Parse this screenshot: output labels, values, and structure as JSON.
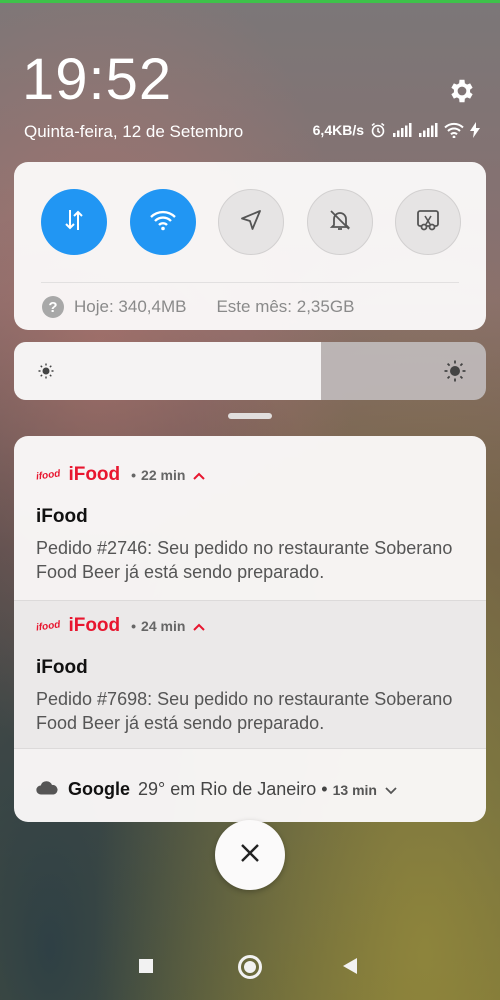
{
  "status_bar": {
    "time": "19:52",
    "date": "Quinta-feira, 12 de Setembro",
    "network_speed": "6,4KB/s",
    "icons": [
      "alarm-icon",
      "signal-icon",
      "signal-icon",
      "wifi-icon",
      "charging-icon"
    ]
  },
  "quick_settings": {
    "toggles": [
      {
        "name": "mobile-data",
        "icon": "data-arrows-icon",
        "active": true
      },
      {
        "name": "wifi",
        "icon": "wifi-icon",
        "active": true
      },
      {
        "name": "location",
        "icon": "location-arrow-icon",
        "active": false
      },
      {
        "name": "silent",
        "icon": "bell-off-icon",
        "active": false
      },
      {
        "name": "screenshot",
        "icon": "scissors-icon",
        "active": false
      }
    ],
    "data_usage": {
      "help_glyph": "?",
      "today": "Hoje: 340,4MB",
      "month": "Este mês: 2,35GB"
    },
    "brightness_level": 0.65
  },
  "notifications": [
    {
      "app_logo": "ifood",
      "app": "iFood",
      "time": "22 min",
      "title": "iFood",
      "body": "Pedido #2746: Seu pedido no restaurante Soberano Food Beer já está sendo preparado."
    },
    {
      "app_logo": "ifood",
      "app": "iFood",
      "time": "24 min",
      "title": "iFood",
      "body": "Pedido #7698: Seu pedido no restaurante Soberano Food Beer já está sendo preparado."
    }
  ],
  "weather": {
    "icon": "cloud-icon",
    "app": "Google",
    "text": "29° em Rio de Janeiro",
    "time": "13 min"
  },
  "colors": {
    "accent": "#2196f3",
    "ifood_red": "#e8162f"
  }
}
